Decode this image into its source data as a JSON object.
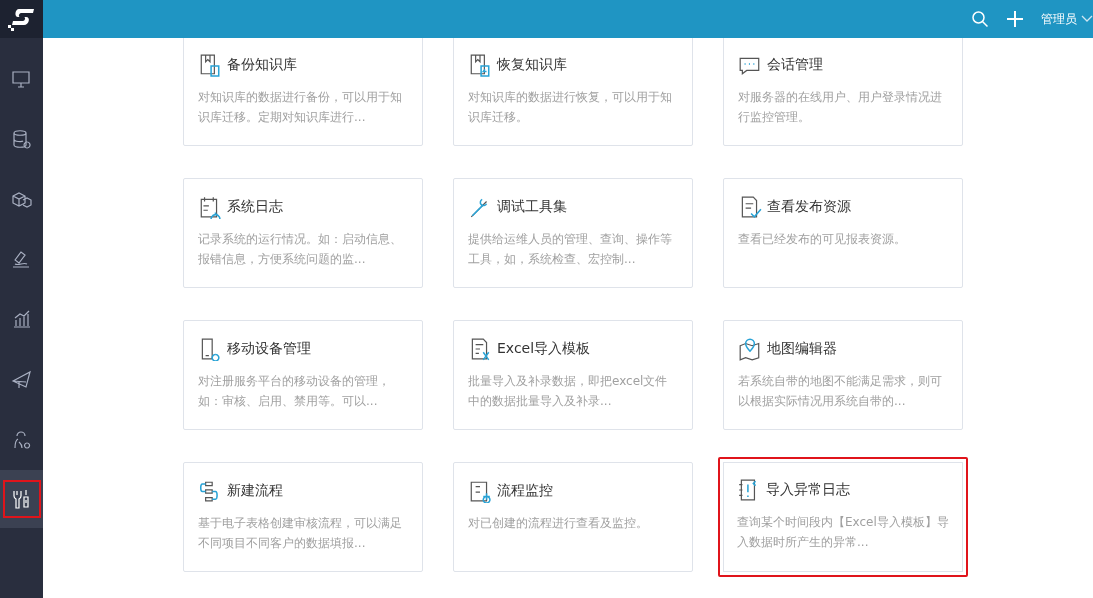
{
  "header": {
    "user": "管理员"
  },
  "sidebar": {
    "items": [
      {
        "selected": false
      },
      {
        "selected": false
      },
      {
        "selected": false
      },
      {
        "selected": false
      },
      {
        "selected": false
      },
      {
        "selected": false
      },
      {
        "selected": false
      },
      {
        "selected": true
      }
    ]
  },
  "cards": [
    {
      "title": "备份知识库",
      "description": "对知识库的数据进行备份，可以用于知识库迁移。定期对知识库进行...",
      "highlighted": false
    },
    {
      "title": "恢复知识库",
      "description": "对知识库的数据进行恢复，可以用于知识库迁移。",
      "highlighted": false
    },
    {
      "title": "会话管理",
      "description": "对服务器的在线用户、用户登录情况进行监控管理。",
      "highlighted": false
    },
    {
      "title": "系统日志",
      "description": "记录系统的运行情况。如：启动信息、报错信息，方便系统问题的监...",
      "highlighted": false
    },
    {
      "title": "调试工具集",
      "description": "提供给运维人员的管理、查询、操作等工具，如，系统检查、宏控制...",
      "highlighted": false
    },
    {
      "title": "查看发布资源",
      "description": "查看已经发布的可见报表资源。",
      "highlighted": false
    },
    {
      "title": "移动设备管理",
      "description": "对注册服务平台的移动设备的管理，如：审核、启用、禁用等。可以...",
      "highlighted": false
    },
    {
      "title": "Excel导入模板",
      "description": "批量导入及补录数据，即把excel文件中的数据批量导入及补录...",
      "highlighted": false
    },
    {
      "title": "地图编辑器",
      "description": "若系统自带的地图不能满足需求，则可以根据实际情况用系统自带的...",
      "highlighted": false
    },
    {
      "title": "新建流程",
      "description": "基于电子表格创建审核流程，可以满足不同项目不同客户的数据填报...",
      "highlighted": false
    },
    {
      "title": "流程监控",
      "description": "对已创建的流程进行查看及监控。",
      "highlighted": false
    },
    {
      "title": "导入异常日志",
      "description": "查询某个时间段内【Excel导入模板】导入数据时所产生的异常...",
      "highlighted": true
    }
  ]
}
